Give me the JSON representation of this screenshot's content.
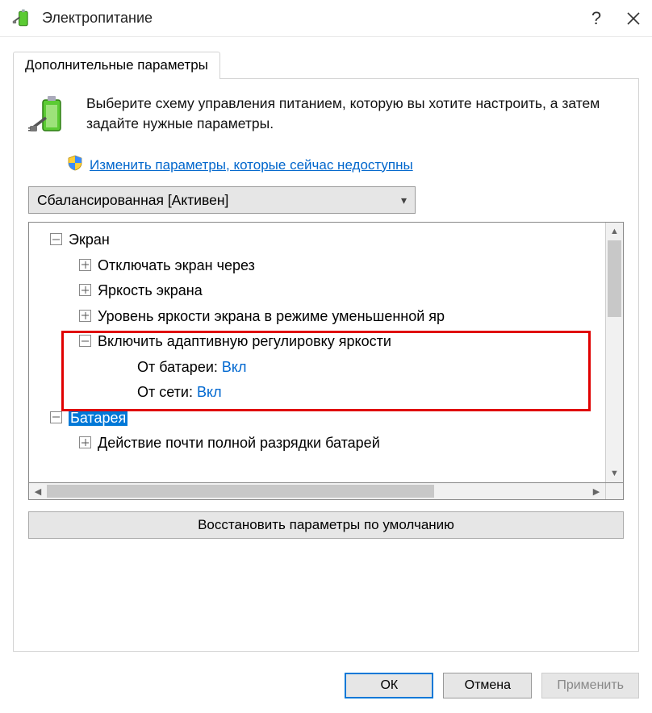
{
  "titlebar": {
    "title": "Электропитание"
  },
  "tab": {
    "label": "Дополнительные параметры"
  },
  "intro": {
    "text": "Выберите схему управления питанием, которую вы хотите настроить, а затем задайте нужные параметры."
  },
  "shield_link": {
    "text": "Изменить параметры, которые сейчас недоступны"
  },
  "plan": {
    "selected": "Сбалансированная [Активен]"
  },
  "tree": {
    "screen": {
      "label": "Экран",
      "turn_off": "Отключать экран через",
      "brightness": "Яркость экрана",
      "dim_level": "Уровень яркости экрана в режиме уменьшенной яр",
      "adaptive": {
        "label": "Включить адаптивную регулировку яркости",
        "battery_label": "От батареи:",
        "battery_value": "Вкл",
        "ac_label": "От сети:",
        "ac_value": "Вкл"
      }
    },
    "battery_section": {
      "label": "Батарея",
      "low_action": "Действие почти полной разрядки батарей"
    }
  },
  "restore_defaults": {
    "label": "Восстановить параметры по умолчанию"
  },
  "footer": {
    "ok": "ОК",
    "cancel": "Отмена",
    "apply": "Применить"
  }
}
